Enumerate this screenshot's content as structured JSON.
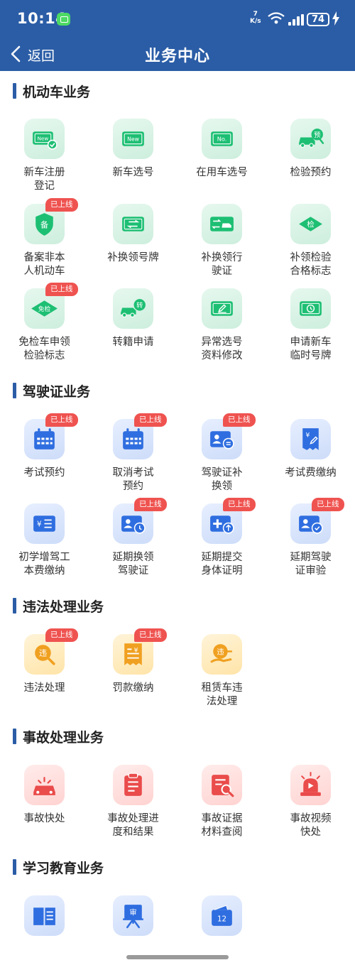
{
  "status_bar": {
    "time": "10:14",
    "net_speed_value": "7",
    "net_speed_unit": "K/s",
    "battery": "74"
  },
  "header": {
    "back_label": "返回",
    "title": "业务中心"
  },
  "badge_text": "已上线",
  "sections": {
    "motor": {
      "title": "机动车业务"
    },
    "license": {
      "title": "驾驶证业务"
    },
    "violation": {
      "title": "违法处理业务"
    },
    "accident": {
      "title": "事故处理业务"
    },
    "education": {
      "title": "学习教育业务"
    }
  },
  "items": {
    "m1": "新车注册\n登记",
    "m2": "新车选号",
    "m3": "在用车选号",
    "m4": "检验预约",
    "m5": "备案非本\n人机动车",
    "m6": "补换领号牌",
    "m7": "补换领行\n驶证",
    "m8": "补领检验\n合格标志",
    "m9": "免检车申领\n检验标志",
    "m10": "转籍申请",
    "m11": "异常选号\n资料修改",
    "m12": "申请新车\n临时号牌",
    "l1": "考试预约",
    "l2": "取消考试\n预约",
    "l3": "驾驶证补\n换领",
    "l4": "考试费缴纳",
    "l5": "初学增驾工\n本费缴纳",
    "l6": "延期换领\n驾驶证",
    "l7": "延期提交\n身体证明",
    "l8": "延期驾驶\n证审验",
    "v1": "违法处理",
    "v2": "罚款缴纳",
    "v3": "租赁车违\n法处理",
    "a1": "事故快处",
    "a2": "事故处理进\n度和结果",
    "a3": "事故证据\n材料查阅",
    "a4": "事故视频\n快处"
  },
  "icon_text": {
    "new": "New",
    "no": "No.",
    "yu": "预",
    "bei": "备",
    "jian": "检",
    "mianjian": "免检",
    "zhuan": "转",
    "yuan": "¥",
    "wei": "违",
    "shen": "审",
    "num12": "12"
  },
  "colors": {
    "header_bg": "#2b5da6",
    "badge": "#ef5350",
    "green_icon": "#1dbf73",
    "blue_icon": "#2f6ee0",
    "orange_icon": "#f0a020",
    "red_icon": "#ea4b4b"
  }
}
